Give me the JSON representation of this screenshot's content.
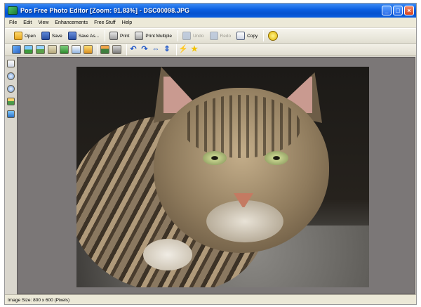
{
  "window": {
    "title": "Pos Free Photo Editor [Zoom: 91.83%] - DSC00098.JPG"
  },
  "menu": [
    "File",
    "Edit",
    "View",
    "Enhancements",
    "Free Stuff",
    "Help"
  ],
  "toolbar": {
    "open": "Open",
    "save": "Save",
    "save_as": "Save As...",
    "print": "Print",
    "print_multiple": "Print Multiple",
    "undo": "Undo",
    "redo": "Redo",
    "copy": "Copy"
  },
  "status": {
    "image_size": "Image Size: 800 x 600 (Pixels)"
  },
  "colors": {
    "titlebar": "#0a5ee0",
    "canvas": "#7b7777",
    "chrome": "#ece9d8"
  }
}
